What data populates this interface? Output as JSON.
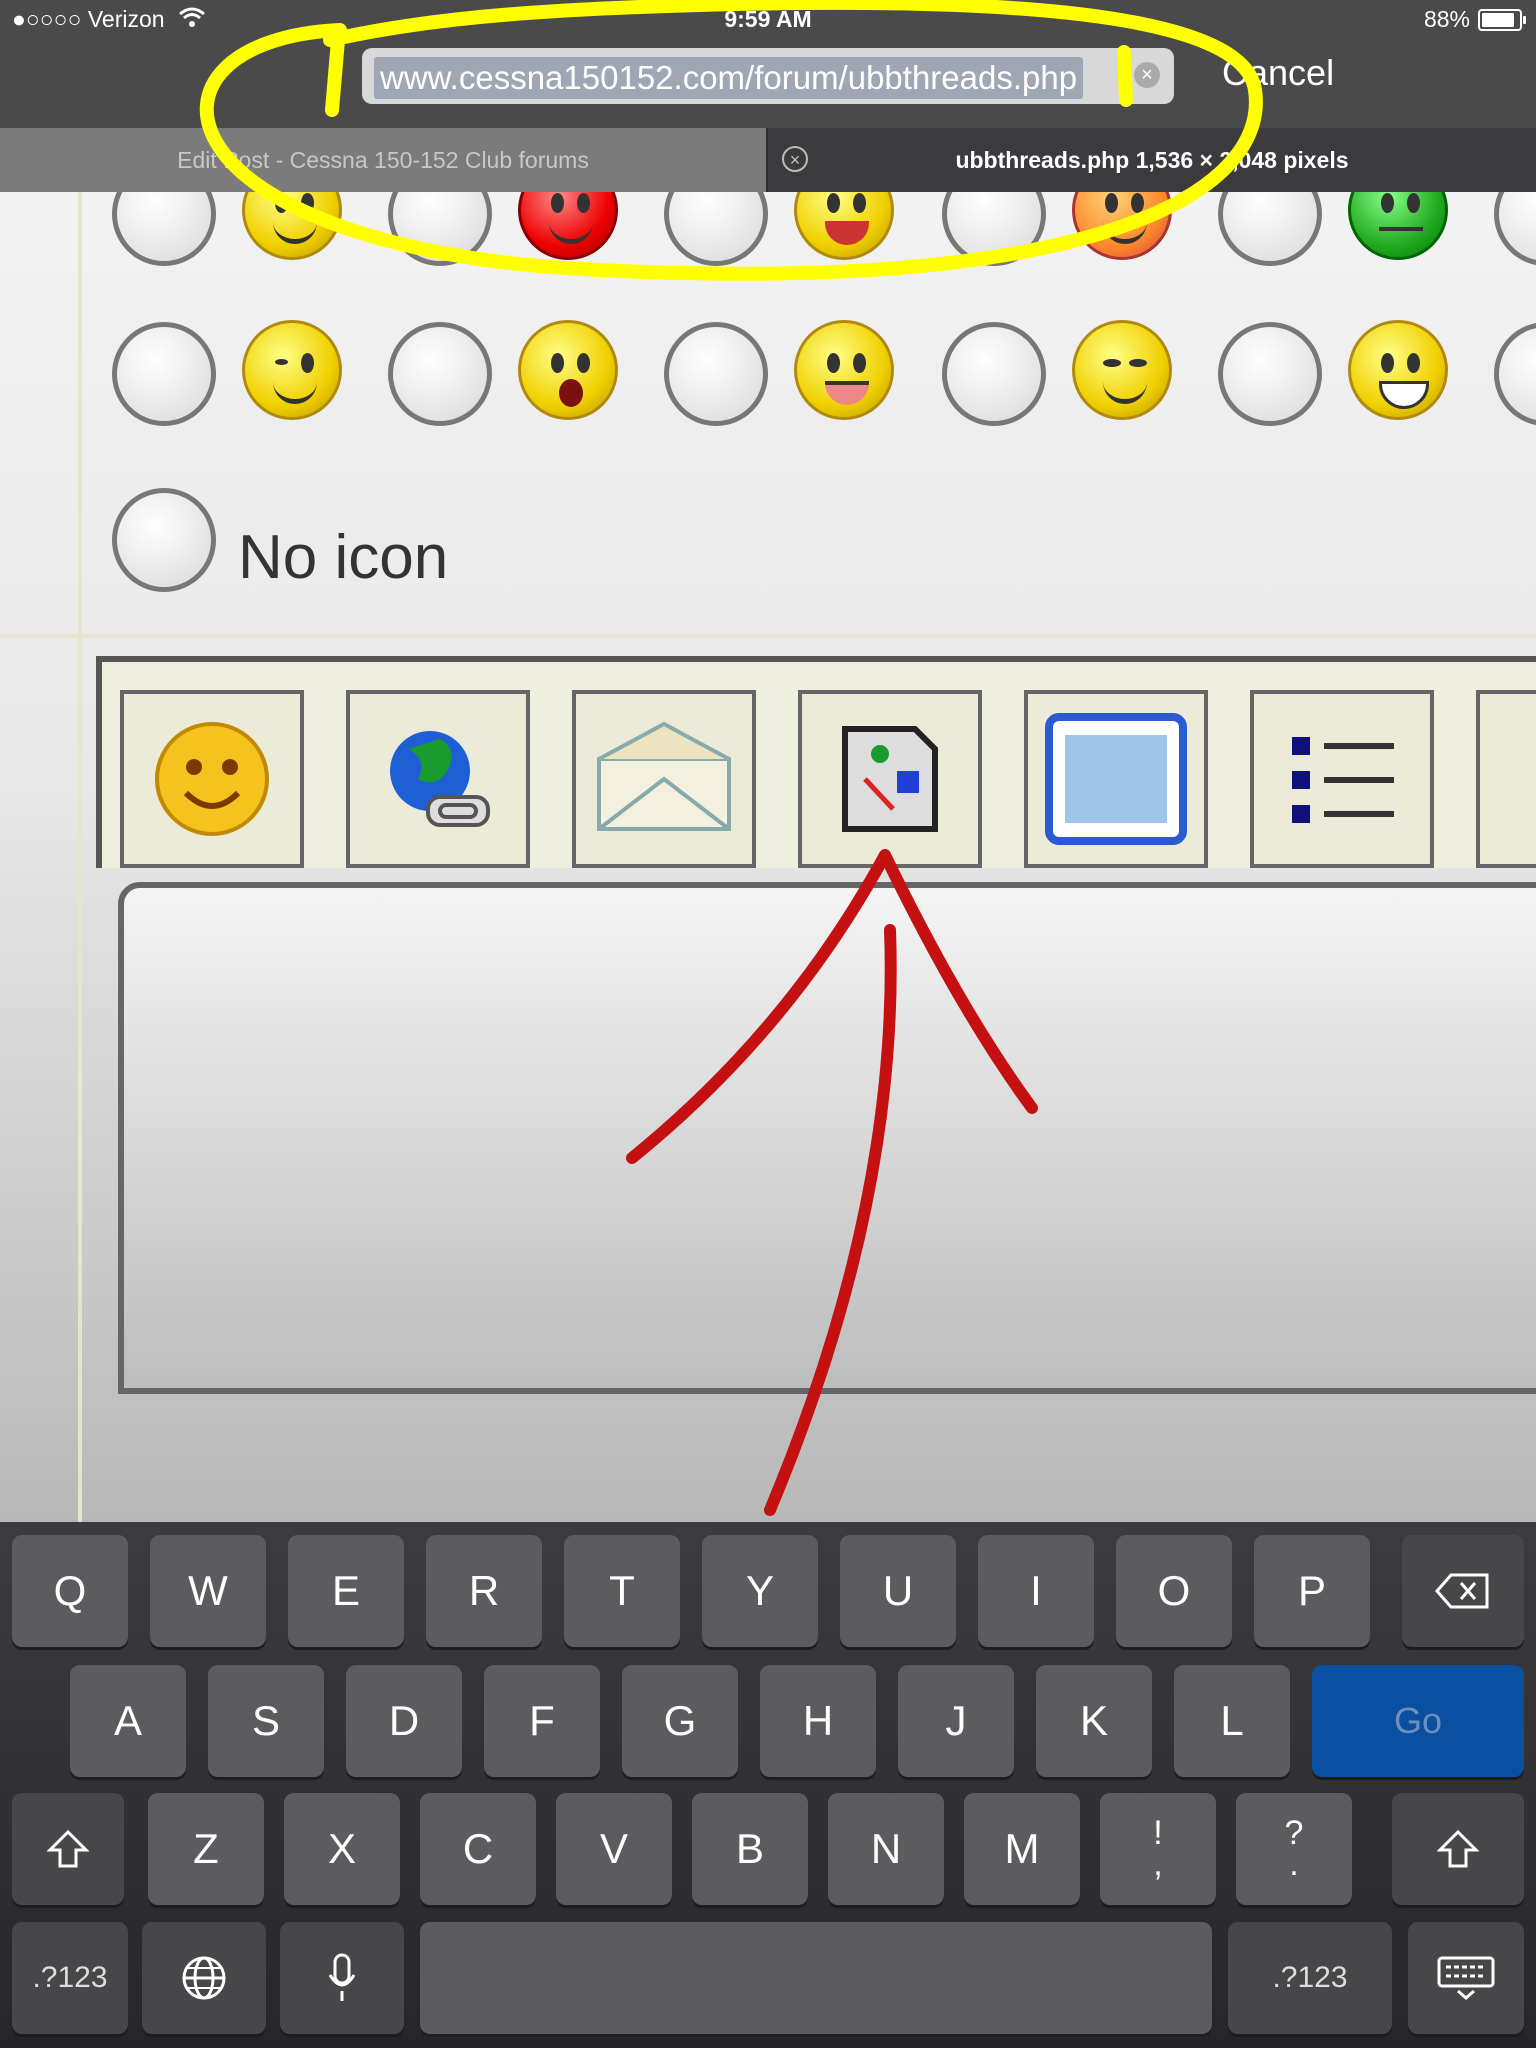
{
  "status_bar": {
    "carrier": "●○○○○ Verizon",
    "time": "9:59 AM",
    "battery": "88%",
    "battery_level": 0.88
  },
  "url_bar": {
    "value": "www.cessna150152.com/forum/ubbthreads.php",
    "cancel_label": "Cancel"
  },
  "tabs": [
    {
      "label": "Edit Post - Cessna 150-152 Club forums"
    },
    {
      "label": "ubbthreads.php 1,536 × 2,048 pixels"
    }
  ],
  "page": {
    "no_icon_label": "No icon"
  },
  "keyboard": {
    "row1": [
      "Q",
      "W",
      "E",
      "R",
      "T",
      "Y",
      "U",
      "I",
      "O",
      "P"
    ],
    "row2": [
      "A",
      "S",
      "D",
      "F",
      "G",
      "H",
      "J",
      "K",
      "L"
    ],
    "row3": [
      "Z",
      "X",
      "C",
      "V",
      "B",
      "N",
      "M",
      "!\n,",
      "?\n."
    ],
    "go_label": "Go",
    "numbers_label": ".?123"
  },
  "icons": [
    "wifi-icon",
    "battery-icon",
    "clear-icon",
    "close-tab-icon",
    "backspace-icon",
    "shift-icon",
    "globe-icon",
    "microphone-icon",
    "hide-keyboard-icon"
  ],
  "colors": {
    "highlight_annotation": "#ffff00",
    "arrow_annotation": "#c41010",
    "go_key": "#0b4fa0"
  }
}
